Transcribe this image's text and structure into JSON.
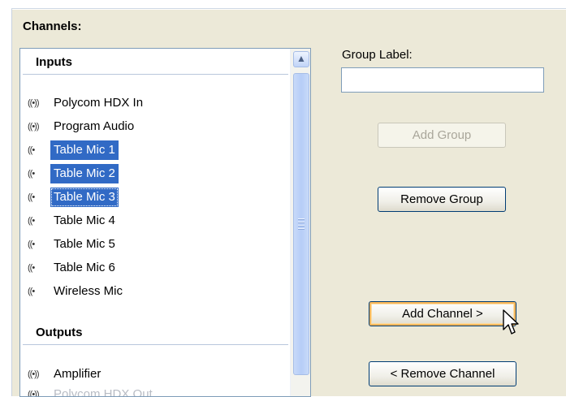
{
  "section_title": "Channels:",
  "inputs_header": "Inputs",
  "outputs_header": "Outputs",
  "inputs": [
    {
      "label": "Polycom HDX In",
      "icon": "stereo-signal-icon",
      "selected": false
    },
    {
      "label": "Program Audio",
      "icon": "stereo-signal-icon",
      "selected": false
    },
    {
      "label": "Table Mic 1",
      "icon": "mono-signal-icon",
      "selected": true
    },
    {
      "label": "Table Mic 2",
      "icon": "mono-signal-icon",
      "selected": true
    },
    {
      "label": "Table Mic 3",
      "icon": "mono-signal-icon",
      "selected": true
    },
    {
      "label": "Table Mic 4",
      "icon": "mono-signal-icon",
      "selected": false
    },
    {
      "label": "Table Mic 5",
      "icon": "mono-signal-icon",
      "selected": false
    },
    {
      "label": "Table Mic 6",
      "icon": "mono-signal-icon",
      "selected": false
    },
    {
      "label": "Wireless Mic",
      "icon": "mono-signal-icon",
      "selected": false
    }
  ],
  "outputs": [
    {
      "label": "Amplifier",
      "icon": "stereo-signal-icon"
    },
    {
      "label": "Polycom HDX Out",
      "icon": "stereo-signal-icon"
    }
  ],
  "group_label": {
    "label": "Group Label:",
    "value": ""
  },
  "buttons": {
    "add_group": "Add Group",
    "remove_group": "Remove Group",
    "add_channel": "Add Channel >",
    "remove_channel": "< Remove Channel"
  },
  "icons": {
    "stereo": "((•))",
    "mono": "((•"
  },
  "colors": {
    "selection": "#316ac5",
    "panel": "#ece9d8",
    "border": "#7f9db9"
  }
}
